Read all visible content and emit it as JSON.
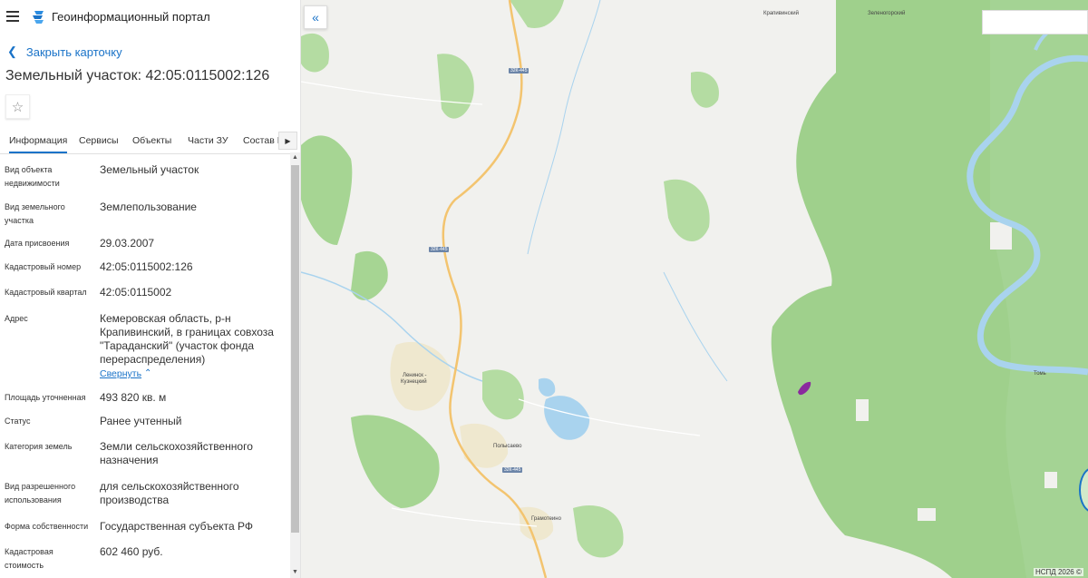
{
  "header": {
    "title": "Геоинформационный портал"
  },
  "card": {
    "close_label": "Закрыть карточку",
    "title": "Земельный участок: 42:05:0115002:126"
  },
  "tabs": [
    {
      "label": "Информация",
      "active": true
    },
    {
      "label": "Сервисы"
    },
    {
      "label": "Объекты"
    },
    {
      "label": "Части ЗУ"
    },
    {
      "label": "Состав Е"
    }
  ],
  "properties": [
    {
      "label": "Вид объекта недвижимости",
      "value": "Земельный участок"
    },
    {
      "label": "Вид земельного участка",
      "value": "Землепользование"
    },
    {
      "label": "Дата присвоения",
      "value": "29.03.2007"
    },
    {
      "label": "Кадастровый номер",
      "value": "42:05:0115002:126"
    },
    {
      "label": "Кадастровый квартал",
      "value": "42:05:0115002"
    },
    {
      "label": "Адрес",
      "value": "Кемеровская область, р-н Крапивинский, в границах совхоза \"Тараданский\" (участок фонда перераспределения)"
    },
    {
      "label": "Площадь уточненная",
      "value": "493 820 кв. м"
    },
    {
      "label": "Статус",
      "value": "Ранее учтенный"
    },
    {
      "label": "Категория земель",
      "value": "Земли сельскохозяйственного назначения"
    },
    {
      "label": "Вид разрешенного использования",
      "value": "для сельскохозяйственного производства"
    },
    {
      "label": "Форма собственности",
      "value": "Государственная субъекта РФ"
    },
    {
      "label": "Кадастровая стоимость",
      "value": "602 460 руб."
    }
  ],
  "collapse_label": "Свернуть",
  "map": {
    "places": {
      "krapivinsky": "Крапивинский",
      "zelenogorsky": "Зеленогорский",
      "leninsk_1": "Ленинск -",
      "leninsk_2": "Кузнецкий",
      "polysaevo": "Полысаево",
      "gramoteino": "Грамотеино",
      "tom": "Томь"
    },
    "road_labels": {
      "r1": "32К-445",
      "r2": "32К-445",
      "r3": "32К-445"
    },
    "copyright": "НСПД 2026 ©"
  },
  "colors": {
    "accent": "#1a73c8",
    "forest": "#9fd08c",
    "forest_dark": "#8cc77a",
    "water": "#a9d3ee",
    "parcel": "#8a2a9e"
  }
}
